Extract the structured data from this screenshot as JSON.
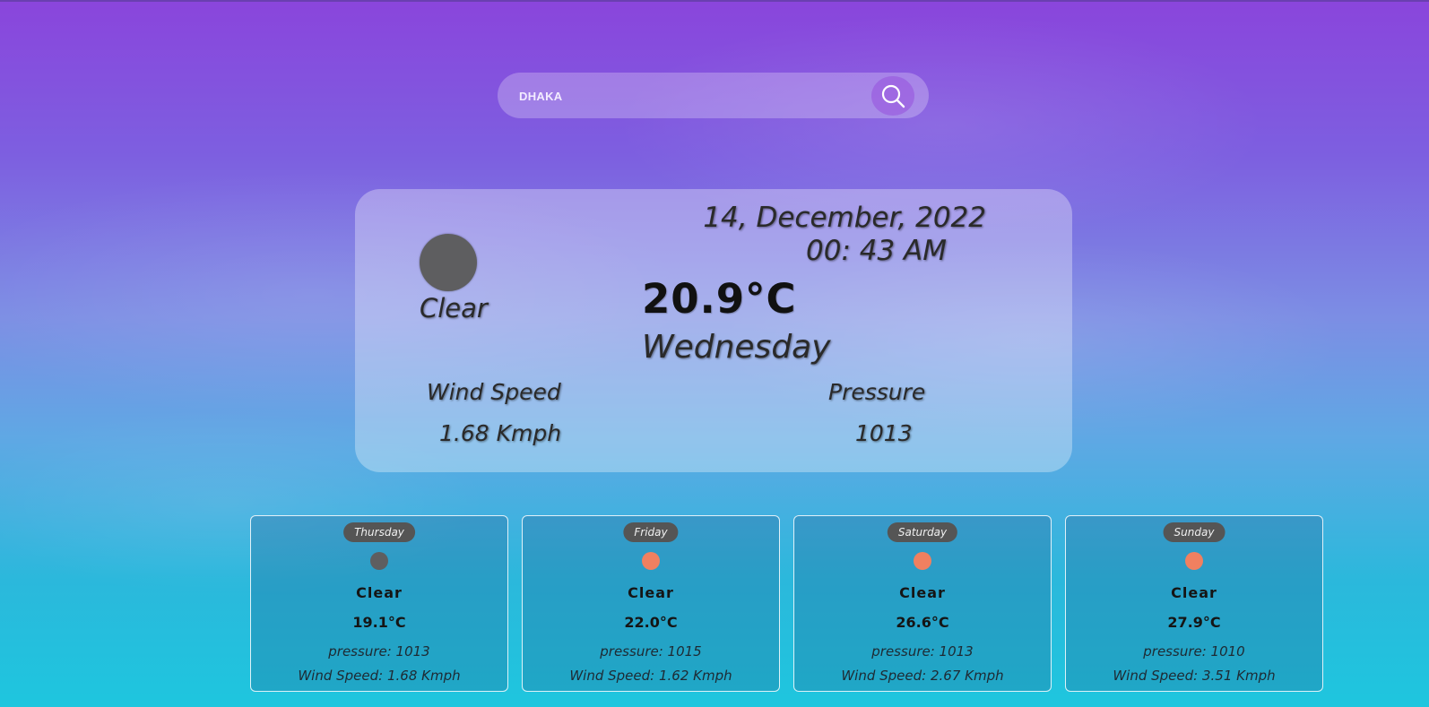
{
  "search": {
    "value": "DHAKA",
    "button_icon": "search-icon"
  },
  "current": {
    "date": "14, December, 2022",
    "time": "00: 43 AM",
    "condition": "Clear",
    "temperature": "20.9°C",
    "day": "Wednesday",
    "wind_label": "Wind Speed",
    "wind_value": "1.68 Kmph",
    "pressure_label": "Pressure",
    "pressure_value": "1013",
    "icon": "weather-icon",
    "icon_color": "#5e5e60"
  },
  "forecast": [
    {
      "day": "Thursday",
      "condition": "Clear",
      "temp": "19.1°C",
      "pressure": "pressure: 1013",
      "wind": "Wind Speed: 1.68 Kmph",
      "icon_color": "#5e5e60"
    },
    {
      "day": "Friday",
      "condition": "Clear",
      "temp": "22.0°C",
      "pressure": "pressure: 1015",
      "wind": "Wind Speed: 1.62 Kmph",
      "icon_color": "#f08060"
    },
    {
      "day": "Saturday",
      "condition": "Clear",
      "temp": "26.6°C",
      "pressure": "pressure: 1013",
      "wind": "Wind Speed: 2.67 Kmph",
      "icon_color": "#f08060"
    },
    {
      "day": "Sunday",
      "condition": "Clear",
      "temp": "27.9°C",
      "pressure": "pressure: 1010",
      "wind": "Wind Speed: 3.51 Kmph",
      "icon_color": "#f08060"
    }
  ]
}
